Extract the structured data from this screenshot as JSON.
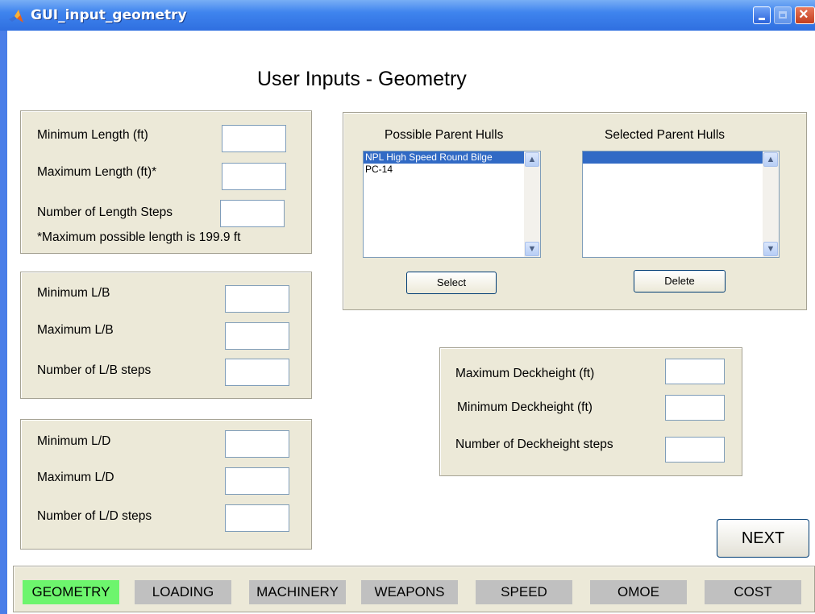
{
  "window": {
    "title": "GUI_input_geometry",
    "app_icon": "matlab-icon"
  },
  "page": {
    "title": "User Inputs - Geometry"
  },
  "length_panel": {
    "min_label": "Minimum Length (ft)",
    "max_label": "Maximum Length (ft)*",
    "steps_label": "Number of Length Steps",
    "note": "*Maximum possible length is 199.9 ft",
    "min_value": "",
    "max_value": "",
    "steps_value": ""
  },
  "lb_panel": {
    "min_label": "Minimum L/B",
    "max_label": "Maximum L/B",
    "steps_label": "Number of L/B steps",
    "min_value": "",
    "max_value": "",
    "steps_value": ""
  },
  "ld_panel": {
    "min_label": "Minimum L/D",
    "max_label": "Maximum L/D",
    "steps_label": "Number of L/D steps",
    "min_value": "",
    "max_value": "",
    "steps_value": ""
  },
  "hulls_panel": {
    "possible_label": "Possible Parent Hulls",
    "selected_label": "Selected Parent Hulls",
    "possible_items": [
      "NPL High Speed Round Bilge",
      "PC-14"
    ],
    "selected_items": [
      ""
    ],
    "select_button": "Select",
    "delete_button": "Delete"
  },
  "deck_panel": {
    "max_label": "Maximum Deckheight (ft)",
    "min_label": "Minimum Deckheight (ft)",
    "steps_label": "Number of Deckheight steps",
    "max_value": "",
    "min_value": "",
    "steps_value": ""
  },
  "next_button": "NEXT",
  "nav": {
    "tabs": [
      "GEOMETRY",
      "LOADING",
      "MACHINERY",
      "WEAPONS",
      "SPEED",
      "OMOE",
      "COST"
    ],
    "active": "GEOMETRY"
  },
  "colors": {
    "title_bar": "#3f84ee",
    "panel_bg": "#ece9d8",
    "active_tab": "#6df56d",
    "inactive_tab": "#c0c0c0",
    "list_selection": "#316ac5"
  }
}
